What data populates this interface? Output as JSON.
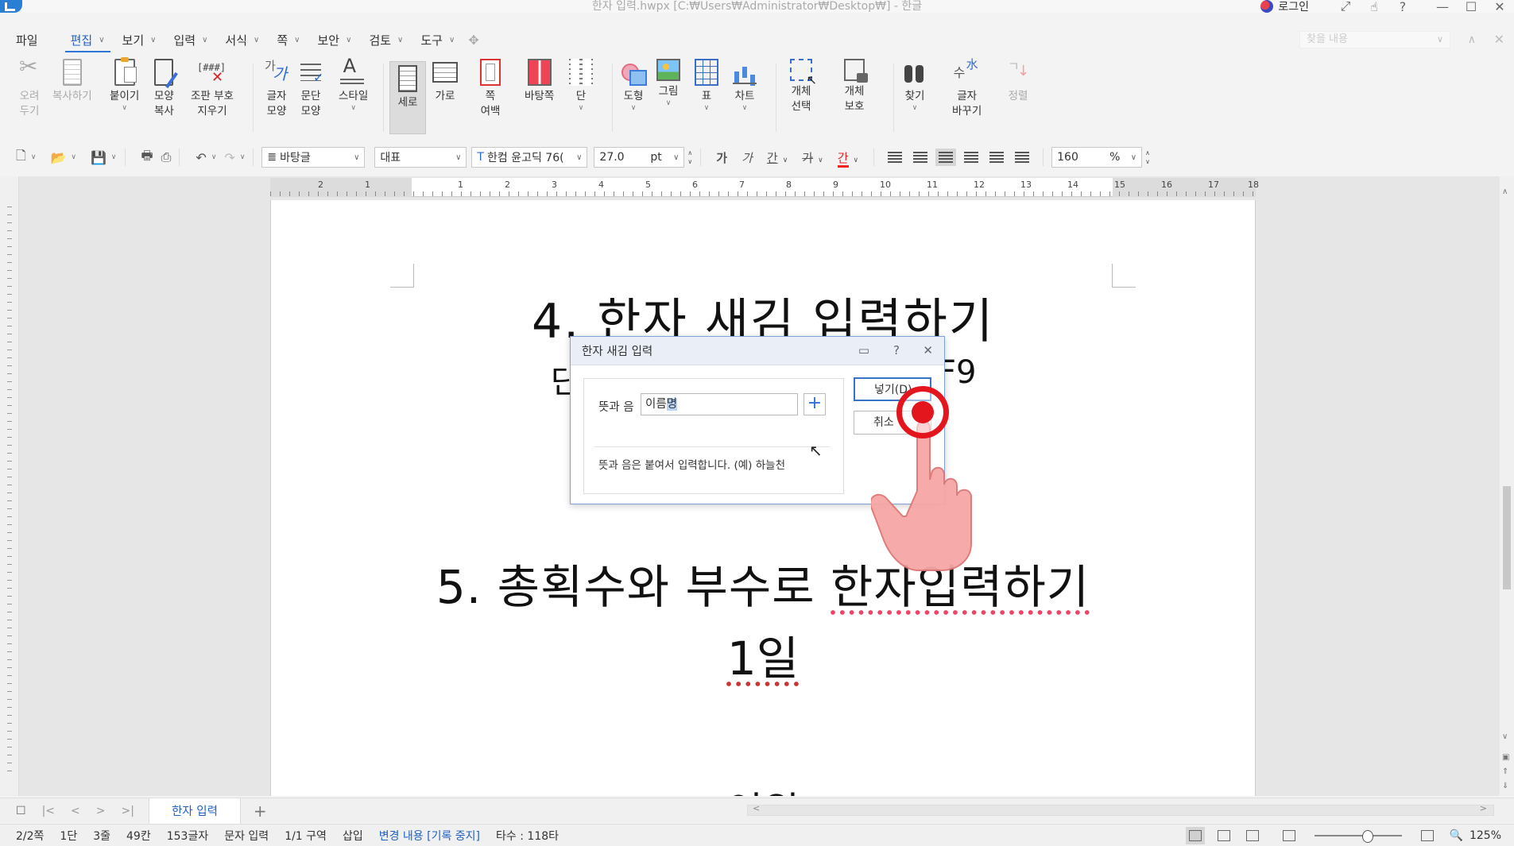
{
  "window": {
    "title": "한자 입력.hwpx [C:₩Users₩Administrator₩Desktop₩] - 한글",
    "login_label": "로그인"
  },
  "menu": {
    "file": "파일",
    "items": [
      {
        "label": "편집",
        "active": true
      },
      {
        "label": "보기"
      },
      {
        "label": "입력"
      },
      {
        "label": "서식"
      },
      {
        "label": "쪽"
      },
      {
        "label": "보안"
      },
      {
        "label": "검토"
      },
      {
        "label": "도구"
      }
    ],
    "search_placeholder": "찾을 내용"
  },
  "ribbon": {
    "cut": [
      "오려",
      "두기"
    ],
    "copy": "복사하기",
    "paste": "붙이기",
    "format_copy": [
      "모양",
      "복사"
    ],
    "clear_codes": [
      "조판 부호",
      "지우기"
    ],
    "char_shape": [
      "글자",
      "모양"
    ],
    "para_shape": [
      "문단",
      "모양"
    ],
    "style": "스타일",
    "portrait": "세로",
    "landscape": "가로",
    "page_margin": [
      "쪽",
      "여백"
    ],
    "page_bg": "바탕쪽",
    "columns": "단",
    "shape": "도형",
    "picture": "그림",
    "table": "표",
    "chart": "차트",
    "obj_select": [
      "개체",
      "선택"
    ],
    "obj_protect": [
      "개체",
      "보호"
    ],
    "find": "찾기",
    "replace": [
      "글자",
      "바꾸기"
    ],
    "sort": "정렬"
  },
  "toolbar": {
    "style_combo": "바탕글",
    "lang_combo": "대표",
    "font_combo": "한컴 윤고딕 76(",
    "font_size": "27.0",
    "size_unit": "pt",
    "bold": "가",
    "italic": "가",
    "underline": "간",
    "strike": "가",
    "color": "간",
    "zoom": "160",
    "zoom_unit": "%"
  },
  "ruler": {
    "numbers": [
      "2",
      "1",
      "1",
      "2",
      "3",
      "4",
      "5",
      "6",
      "7",
      "8",
      "9",
      "10",
      "11",
      "12",
      "13",
      "14",
      "15",
      "16",
      "17",
      "18"
    ]
  },
  "document": {
    "heading4": "4. 한자 새김 입력하기",
    "frag_left": "단",
    "frag_right": "F9",
    "heading5_a": "5. 총획수와 부수로 ",
    "heading5_b": "한자입력하기",
    "line_1il": "1일",
    "line_last": "인원"
  },
  "dialog": {
    "title": "한자 새김 입력",
    "field_label": "뜻과 음",
    "input_value_a": "이름",
    "input_value_b": "명",
    "plus": "+",
    "hint": "뜻과 음은 붙여서 입력합니다. (예) 하늘천",
    "ok_button": "넣기(D)",
    "cancel_button": "취소"
  },
  "tabs": {
    "doc_tab": "한자 입력"
  },
  "status": {
    "page": "2/2쪽",
    "column": "1단",
    "line": "3줄",
    "col": "49칸",
    "chars": "153글자",
    "mode": "문자 입력",
    "section": "1/1 구역",
    "insert": "삽입",
    "track": "변경 내용 [기록 중지]",
    "typing": "타수 : 118타",
    "zoom": "125%"
  },
  "colors": {
    "accent": "#2260c4",
    "tap_red": "#e3161e"
  }
}
